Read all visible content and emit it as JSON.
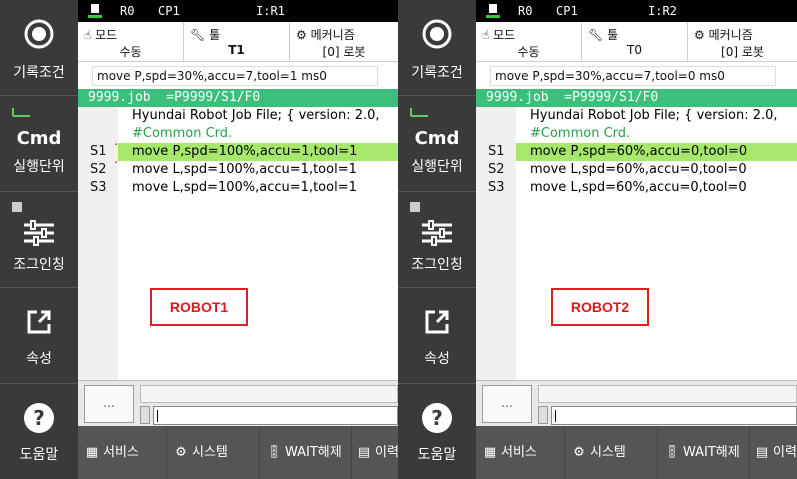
{
  "panels": [
    {
      "sidebar": {
        "record_label": "기록조건",
        "cmd_title": "Cmd",
        "cmd_label": "실행단위",
        "jog_label": "조그인칭",
        "props_label": "속성",
        "help_label": "도움말"
      },
      "status": {
        "robot": "R0",
        "cp": "CP1",
        "io": "I:R1"
      },
      "info": {
        "mode_label": "모드",
        "mode_value": "수동",
        "tool_label": "툴",
        "tool_value": "T1",
        "mech_label": "메커니즘",
        "mech_value": "[0] 로봇"
      },
      "cmdline": "move P,spd=30%,accu=7,tool=1 ms0",
      "job_header": "9999.job  =P9999/S1/F0",
      "lines": [
        {
          "num": "",
          "text": "Hyundai Robot Job File; { version: 2.0,",
          "comment": false,
          "hl": false
        },
        {
          "num": "",
          "text": "#Common Crd.",
          "comment": true,
          "hl": false
        },
        {
          "num": "S1",
          "text": "move P,spd=100%,accu=1,tool=1",
          "comment": false,
          "hl": true
        },
        {
          "num": "S2",
          "text": "move L,spd=100%,accu=1,tool=1",
          "comment": false,
          "hl": false
        },
        {
          "num": "S3",
          "text": "move L,spd=100%,accu=1,tool=1",
          "comment": false,
          "hl": false
        }
      ],
      "robot_label": "ROBOT1",
      "dots_button": "...",
      "bottom": {
        "service": "서비스",
        "system": "시스템",
        "wait": "WAIT해제",
        "history": "이력"
      }
    },
    {
      "sidebar": {
        "record_label": "기록조건",
        "cmd_title": "Cmd",
        "cmd_label": "실행단위",
        "jog_label": "조그인칭",
        "props_label": "속성",
        "help_label": "도움말"
      },
      "status": {
        "robot": "R0",
        "cp": "CP1",
        "io": "I:R2"
      },
      "info": {
        "mode_label": "모드",
        "mode_value": "수동",
        "tool_label": "툴",
        "tool_value": "T0",
        "mech_label": "메커니즘",
        "mech_value": "[0] 로봇"
      },
      "cmdline": "move P,spd=30%,accu=7,tool=0 ms0",
      "job_header": "9999.job  =P9999/S1/F0",
      "lines": [
        {
          "num": "",
          "text": "Hyundai Robot Job File; { version: 2.0,",
          "comment": false,
          "hl": false
        },
        {
          "num": "",
          "text": "#Common Crd.",
          "comment": true,
          "hl": false
        },
        {
          "num": "S1",
          "text": "move P,spd=60%,accu=0,tool=0",
          "comment": false,
          "hl": true
        },
        {
          "num": "S2",
          "text": "move L,spd=60%,accu=0,tool=0",
          "comment": false,
          "hl": false
        },
        {
          "num": "S3",
          "text": "move L,spd=60%,accu=0,tool=0",
          "comment": false,
          "hl": false
        }
      ],
      "robot_label": "ROBOT2",
      "dots_button": "...",
      "bottom": {
        "service": "서비스",
        "system": "시스템",
        "wait": "WAIT해제",
        "history": "이력"
      }
    }
  ],
  "colors": {
    "sidebar": "#3a3a3a",
    "job_header": "#3cbf7c",
    "highlight": "#a6e86b",
    "robot_label": "#d91a1a"
  }
}
